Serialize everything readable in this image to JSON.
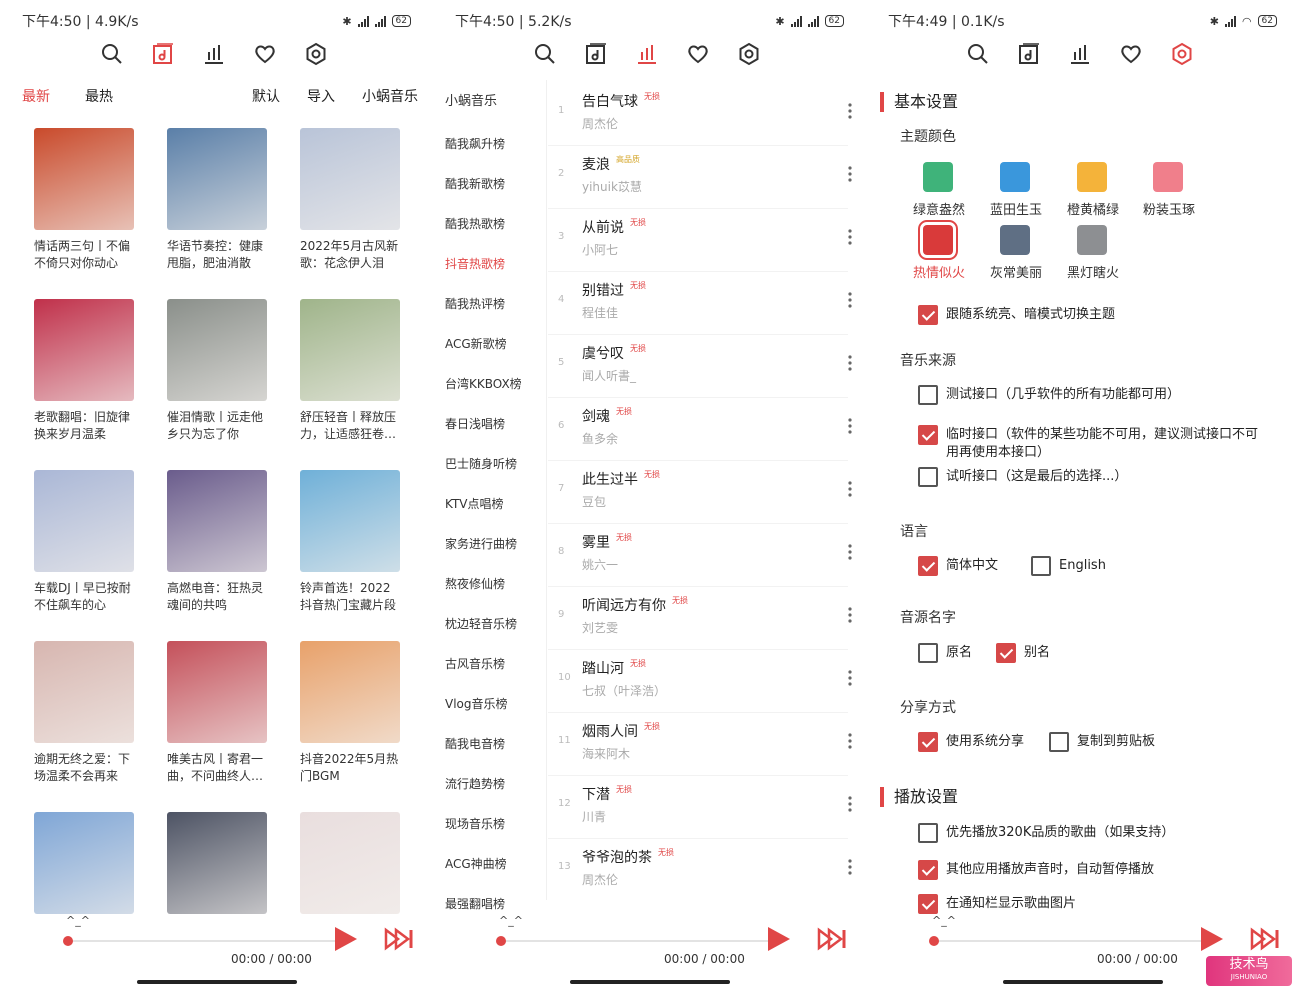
{
  "accent": "#e04646",
  "panels": [
    {
      "status": {
        "time": "下午4:50 | 4.9K/s",
        "battery": "62"
      }
    },
    {
      "status": {
        "time": "下午4:50 | 5.2K/s",
        "battery": "62"
      }
    },
    {
      "status": {
        "time": "下午4:49 | 0.1K/s",
        "battery": "62"
      }
    }
  ],
  "nav_icons": [
    "search-icon",
    "music-library-icon",
    "chart-icon",
    "heart-icon",
    "settings-icon"
  ],
  "explore": {
    "tabs": {
      "latest": "最新",
      "hot": "最热",
      "default": "默认",
      "import": "导入",
      "source": "小蜗音乐"
    },
    "playlists": [
      {
        "title": "情话两三句丨不偏不倚只对你动心",
        "color": "#c94a2b"
      },
      {
        "title": "华语节奏控：健康甩脂，肥油消散",
        "color": "#5a7fa8"
      },
      {
        "title": "2022年5月古风新歌：花念伊人泪",
        "color": "#b9c4d8"
      },
      {
        "title": "老歌翻唱：旧旋律换来岁月温柔",
        "color": "#c0304a"
      },
      {
        "title": "催泪情歌丨远走他乡只为忘了你",
        "color": "#8a8f8a"
      },
      {
        "title": "舒压轻音丨释放压力，让适感狂卷…",
        "color": "#9fb48a"
      },
      {
        "title": "车载DJ丨早已按耐不住飙车的心",
        "color": "#aab7d6"
      },
      {
        "title": "高燃电音：狂热灵魂间的共鸣",
        "color": "#6a5c8c"
      },
      {
        "title": "铃声首选！2022抖音热门宝藏片段",
        "color": "#6fb0d8"
      },
      {
        "title": "逾期无终之爱：下场温柔不会再来",
        "color": "#d7b6b0"
      },
      {
        "title": "唯美古风丨寄君一曲，不问曲终人…",
        "color": "#c4505a"
      },
      {
        "title": "抖音2022年5月热门BGM",
        "color": "#e8a16a"
      },
      {
        "title": "",
        "color": "#7fa6d6"
      },
      {
        "title": "",
        "color": "#4d5364"
      },
      {
        "title": "",
        "color": "#e9dede"
      }
    ]
  },
  "ranking": {
    "source": "小蜗音乐",
    "lists": [
      "酷我飙升榜",
      "酷我新歌榜",
      "酷我热歌榜",
      "抖音热歌榜",
      "酷我热评榜",
      "ACG新歌榜",
      "台湾KKBOX榜",
      "春日浅唱榜",
      "巴士随身听榜",
      "KTV点唱榜",
      "家务进行曲榜",
      "熬夜修仙榜",
      "枕边轻音乐榜",
      "古风音乐榜",
      "Vlog音乐榜",
      "酷我电音榜",
      "流行趋势榜",
      "现场音乐榜",
      "ACG神曲榜",
      "最强翻唱榜"
    ],
    "active_index": 3,
    "songs": [
      {
        "idx": "1",
        "name": "告白气球",
        "tag": "无损",
        "artist": "周杰伦"
      },
      {
        "idx": "2",
        "name": "麦浪",
        "tag": "高品质",
        "artist": "yihuik苡慧"
      },
      {
        "idx": "3",
        "name": "从前说",
        "tag": "无损",
        "artist": "小阿七"
      },
      {
        "idx": "4",
        "name": "别错过",
        "tag": "无损",
        "artist": "程佳佳"
      },
      {
        "idx": "5",
        "name": "虞兮叹",
        "tag": "无损",
        "artist": "闻人听書_"
      },
      {
        "idx": "6",
        "name": "剑魂",
        "tag": "无损",
        "artist": "鱼多余"
      },
      {
        "idx": "7",
        "name": "此生过半",
        "tag": "无损",
        "artist": "豆包"
      },
      {
        "idx": "8",
        "name": "雾里",
        "tag": "无损",
        "artist": "姚六一"
      },
      {
        "idx": "9",
        "name": "听闻远方有你",
        "tag": "无损",
        "artist": "刘艺雯"
      },
      {
        "idx": "10",
        "name": "踏山河",
        "tag": "无损",
        "artist": "七叔（叶泽浩）"
      },
      {
        "idx": "11",
        "name": "烟雨人间",
        "tag": "无损",
        "artist": "海来阿木"
      },
      {
        "idx": "12",
        "name": "下潜",
        "tag": "无损",
        "artist": "川青"
      },
      {
        "idx": "13",
        "name": "爷爷泡的茶",
        "tag": "无损",
        "artist": "周杰伦"
      }
    ]
  },
  "settings": {
    "basic_title": "基本设置",
    "theme_title": "主题颜色",
    "themes": [
      {
        "name": "绿意盎然",
        "color": "#3fb37a",
        "selected": false
      },
      {
        "name": "蓝田生玉",
        "color": "#3a97dc",
        "selected": false
      },
      {
        "name": "橙黄橘绿",
        "color": "#f4b33a",
        "selected": false
      },
      {
        "name": "粉装玉琢",
        "color": "#f07f8b",
        "selected": false
      },
      {
        "name": "热情似火",
        "color": "#d93a3a",
        "selected": true
      },
      {
        "name": "灰常美丽",
        "color": "#5f6f84",
        "selected": false
      },
      {
        "name": "黑灯瞎火",
        "color": "#8d8f92",
        "selected": false
      }
    ],
    "follow_system": {
      "label": "跟随系统亮、暗模式切换主题",
      "checked": true
    },
    "source_title": "音乐来源",
    "sources": [
      {
        "label": "测试接口（几乎软件的所有功能都可用）",
        "checked": false
      },
      {
        "label": "临时接口（软件的某些功能不可用，建议测试接口不可用再使用本接口）",
        "checked": true
      },
      {
        "label": "试听接口（这是最后的选择...）",
        "checked": false
      }
    ],
    "language_title": "语言",
    "languages": [
      {
        "label": "简体中文",
        "checked": true
      },
      {
        "label": "English",
        "checked": false
      }
    ],
    "name_title": "音源名字",
    "names": [
      {
        "label": "原名",
        "checked": false
      },
      {
        "label": "别名",
        "checked": true
      }
    ],
    "share_title": "分享方式",
    "shares": [
      {
        "label": "使用系统分享",
        "checked": true
      },
      {
        "label": "复制到剪贴板",
        "checked": false
      }
    ],
    "play_title": "播放设置",
    "play": [
      {
        "label": "优先播放320K品质的歌曲（如果支持）",
        "checked": false
      },
      {
        "label": "其他应用播放声音时，自动暂停播放",
        "checked": true
      },
      {
        "label": "在通知栏显示歌曲图片",
        "checked": true
      }
    ]
  },
  "player": {
    "title": "^_^",
    "time": "00:00 / 00:00",
    "progress": 0
  },
  "watermark": {
    "main": "技术鸟",
    "sub": "JISHUNIAO"
  }
}
